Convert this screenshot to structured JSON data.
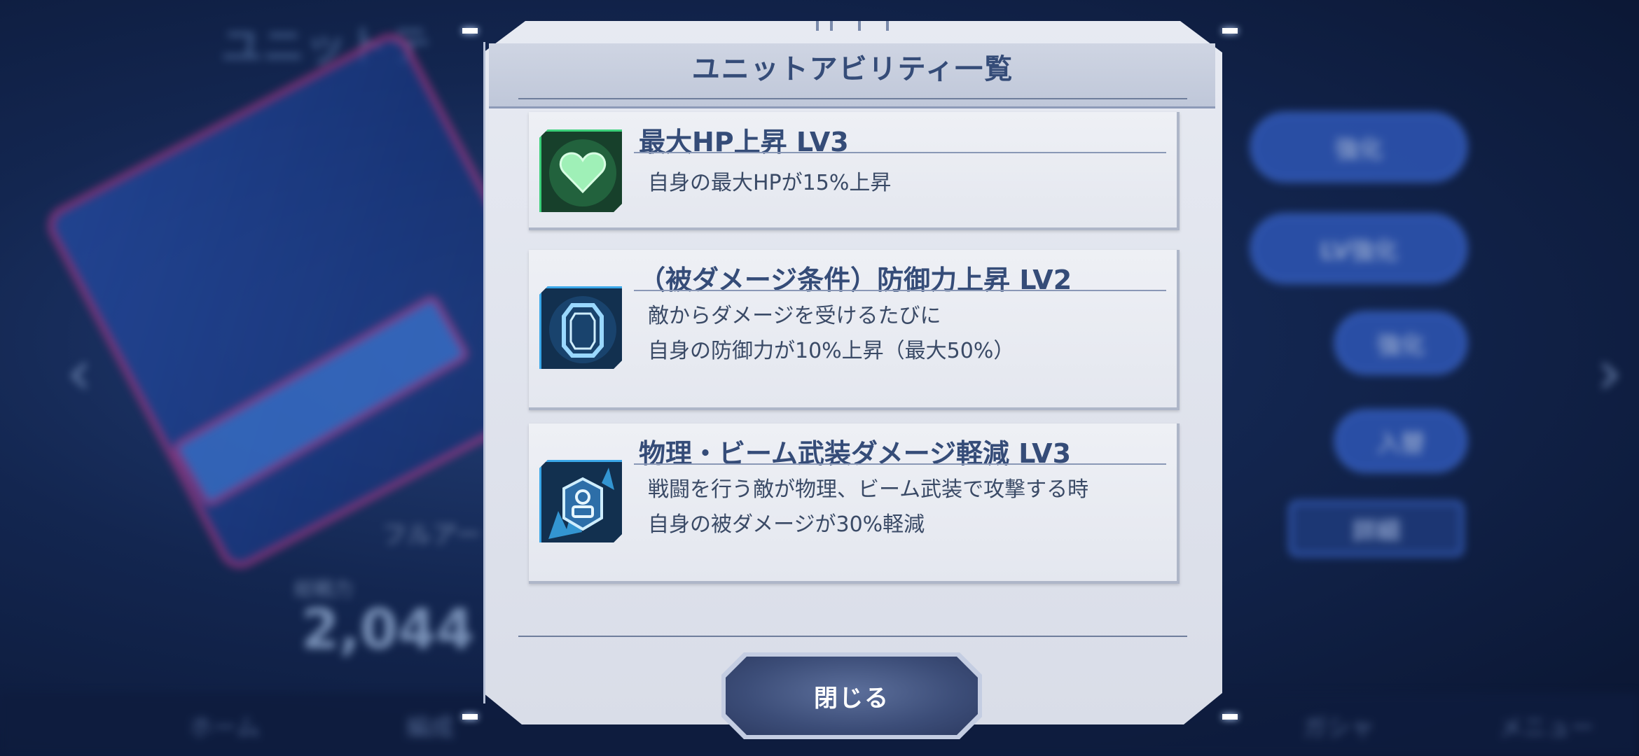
{
  "background": {
    "screen_title": "ユニットテ",
    "full_label": "フルアー",
    "power_label": "総戦力",
    "power_value": "2,044",
    "enhance_label": "強化",
    "lv_enhance_label": "LV強化",
    "detail_label": "詳細",
    "equip_label": "入替",
    "nav": [
      "ホーム",
      "編成",
      "ガシャ",
      "メニュー"
    ]
  },
  "dialog": {
    "title": "ユニットアビリティ一覧",
    "close_label": "閉じる",
    "abilities": [
      {
        "name": "最大HP上昇 LV3",
        "icon": "heart-icon",
        "color": "#3bd07a",
        "description": [
          "自身の最大HPが15%上昇"
        ]
      },
      {
        "name": "（被ダメージ条件）防御力上昇 LV2",
        "icon": "shield-icon",
        "color": "#3aa7e8",
        "description": [
          "敵からダメージを受けるたびに",
          "自身の防御力が10%上昇（最大50%）"
        ]
      },
      {
        "name": "物理・ビーム武装ダメージ軽減 LV3",
        "icon": "armor-icon",
        "color": "#3aa7e8",
        "description": [
          "戦闘を行う敵が物理、ビーム武装で攻撃する時",
          "自身の被ダメージが30%軽減"
        ]
      }
    ]
  }
}
